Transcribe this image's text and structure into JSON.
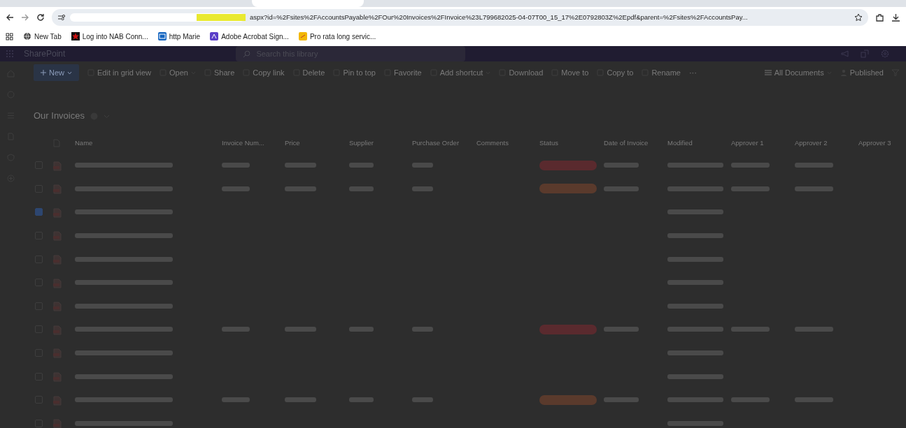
{
  "browser": {
    "url": "aspx?id=%2Fsites%2FAccountsPayable%2FOur%20Invoices%2FInvoice%23L799682025-04-07T00_15_17%2E0792803Z%2Epdf&parent=%2Fsites%2FAccountsPay...",
    "bookmarks": [
      {
        "label": "New Tab"
      },
      {
        "label": "Log into NAB Conn..."
      },
      {
        "label": "http Marie"
      },
      {
        "label": "Adobe Acrobat Sign..."
      },
      {
        "label": "Pro rata long servic..."
      }
    ]
  },
  "app": {
    "name": "SharePoint",
    "search": {
      "placeholder": "Search this library"
    }
  },
  "toolbar": [
    {
      "label": "New",
      "kind": "primary"
    },
    {
      "label": "Edit in grid view",
      "kind": "plain"
    },
    {
      "label": "Open",
      "kind": "menu"
    },
    {
      "label": "Share",
      "kind": "plain"
    },
    {
      "label": "Copy link",
      "kind": "plain"
    },
    {
      "label": "Delete",
      "kind": "plain"
    },
    {
      "label": "Pin to top",
      "kind": "plain"
    },
    {
      "label": "Favorite",
      "kind": "plain"
    },
    {
      "label": "Add shortcut",
      "kind": "menu"
    },
    {
      "label": "Download",
      "kind": "plain"
    },
    {
      "label": "Move to",
      "kind": "plain"
    },
    {
      "label": "Copy to",
      "kind": "plain"
    },
    {
      "label": "Rename",
      "kind": "plain"
    },
    {
      "label": "···",
      "kind": "more"
    }
  ],
  "view": {
    "label": "All Documents",
    "published": "Published"
  },
  "library": {
    "title": "Our Invoices"
  },
  "table": {
    "columns": [
      "Name",
      "Invoice Num...",
      "Price",
      "Supplier",
      "Purchase Order",
      "Comments",
      "Status",
      "Date of Invoice",
      "Modified",
      "Approver 1",
      "Approver 2",
      "Approver 3"
    ],
    "rows": [
      {
        "selected": false,
        "kind": "detailed",
        "status": {
          "color": "#5a2a2e"
        }
      },
      {
        "selected": false,
        "kind": "detailed",
        "status": {
          "color": "#5a3a2c"
        }
      },
      {
        "selected": true,
        "kind": "plain"
      },
      {
        "selected": false,
        "kind": "plain"
      },
      {
        "selected": false,
        "kind": "plain"
      },
      {
        "selected": false,
        "kind": "plain"
      },
      {
        "selected": false,
        "kind": "plain"
      },
      {
        "selected": false,
        "kind": "detailed",
        "status": {
          "color": "#5a2a2e"
        }
      },
      {
        "selected": false,
        "kind": "plain"
      },
      {
        "selected": false,
        "kind": "plain"
      },
      {
        "selected": false,
        "kind": "detailed",
        "status": {
          "color": "#5a3a2c"
        }
      },
      {
        "selected": false,
        "kind": "plain"
      }
    ]
  }
}
